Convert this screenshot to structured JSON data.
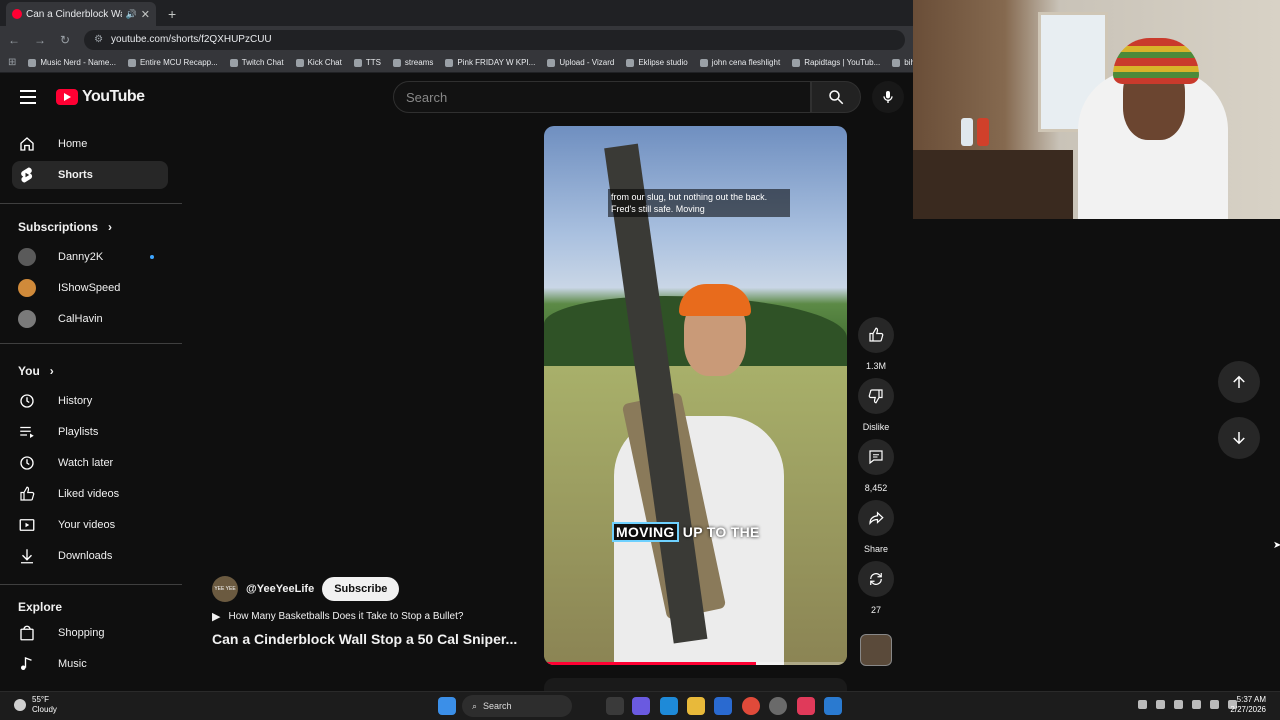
{
  "browser": {
    "tab_title": "Can a Cinderblock Wall Sto...",
    "url": "youtube.com/shorts/f2QXHUPzCUU",
    "bookmarks": [
      "Music Nerd - Name...",
      "Entire MCU Recapp...",
      "Twitch Chat",
      "Kick Chat",
      "TTS",
      "streams",
      "Pink FRIDAY W KPI...",
      "Upload - Vizard",
      "Eklipse studio",
      "john cena fleshlight",
      "Rapidtags | YouTub...",
      "bih links"
    ]
  },
  "header": {
    "logo_text": "YouTube",
    "search_placeholder": "Search"
  },
  "sidebar": {
    "main": [
      {
        "label": "Home",
        "icon": "home-icon"
      },
      {
        "label": "Shorts",
        "icon": "shorts-icon",
        "active": true
      }
    ],
    "subscriptions_title": "Subscriptions",
    "subscriptions": [
      {
        "label": "Danny2K",
        "live": true
      },
      {
        "label": "IShowSpeed"
      },
      {
        "label": "CalHavin"
      }
    ],
    "you_title": "You",
    "you": [
      {
        "label": "History",
        "icon": "history-icon"
      },
      {
        "label": "Playlists",
        "icon": "playlists-icon"
      },
      {
        "label": "Watch later",
        "icon": "clock-icon"
      },
      {
        "label": "Liked videos",
        "icon": "thumbs-up-icon"
      },
      {
        "label": "Your videos",
        "icon": "video-icon"
      },
      {
        "label": "Downloads",
        "icon": "download-icon"
      }
    ],
    "explore_title": "Explore",
    "explore": [
      {
        "label": "Shopping",
        "icon": "shopping-bag-icon"
      },
      {
        "label": "Music",
        "icon": "music-note-icon"
      }
    ]
  },
  "short": {
    "caption_top": "from our slug, but nothing out the back. Fred's still safe. Moving",
    "caption_highlight": "MOVING",
    "caption_rest": " UP TO THE",
    "progress_fraction": 0.7,
    "channel_avatar_text": "YEE YEE",
    "channel": "@YeeYeeLife",
    "subscribe_label": "Subscribe",
    "related_title": "How Many Basketballs Does it Take to Stop a Bullet?",
    "title": "Can a Cinderblock Wall Stop a 50 Cal Sniper..."
  },
  "actions": {
    "likes": "1.3M",
    "dislike_label": "Dislike",
    "comments": "8,452",
    "share_label": "Share",
    "remix_count": "27"
  },
  "taskbar": {
    "temp": "55°F",
    "condition": "Cloudy",
    "search_label": "Search",
    "time": "5:37 AM",
    "date": "2/27/2026"
  }
}
